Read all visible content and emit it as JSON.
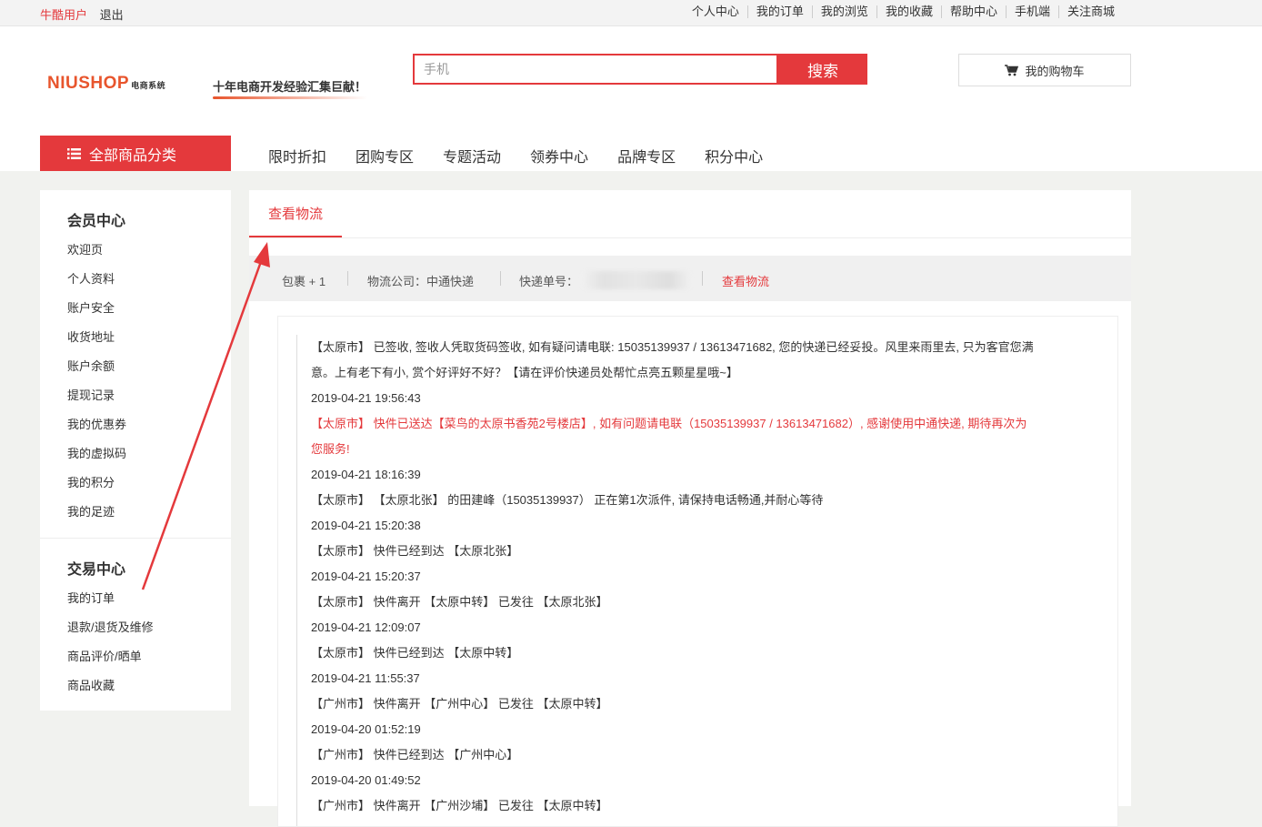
{
  "topbar": {
    "user": "牛酷用户",
    "logout": "退出",
    "links": [
      "个人中心",
      "我的订单",
      "我的浏览",
      "我的收藏",
      "帮助中心",
      "手机端",
      "关注商城"
    ]
  },
  "header": {
    "logo": "NIUSHOP",
    "logo_sub": "电商系统",
    "slogan": "十年电商开发经验汇集巨献！",
    "search_placeholder": "手机",
    "search_button": "搜索",
    "cart_label": "我的购物车"
  },
  "nav": {
    "all_categories": "全部商品分类",
    "items": [
      "限时折扣",
      "团购专区",
      "专题活动",
      "领券中心",
      "品牌专区",
      "积分中心"
    ]
  },
  "sidebar": {
    "member_title": "会员中心",
    "member_items": [
      "欢迎页",
      "个人资料",
      "账户安全",
      "收货地址",
      "账户余额",
      "提现记录",
      "我的优惠券",
      "我的虚拟码",
      "我的积分",
      "我的足迹"
    ],
    "trade_title": "交易中心",
    "trade_items": [
      "我的订单",
      "退款/退货及维修",
      "商品评价/晒单",
      "商品收藏"
    ]
  },
  "main": {
    "tab": "查看物流",
    "package": "包裹 + 1",
    "company": "物流公司：中通快递",
    "tracking_label": "快递单号：",
    "view_link": "查看物流"
  },
  "tracking": [
    {
      "text": "【太原市】 已签收, 签收人凭取货码签收, 如有疑问请电联: 15035139937 / 13613471682, 您的快递已经妥投。风里来雨里去, 只为客官您满",
      "red": false
    },
    {
      "text": "意。上有老下有小, 赏个好评好不好？【请在评价快递员处帮忙点亮五颗星星哦~】",
      "red": false
    },
    {
      "text": "2019-04-21 19:56:43",
      "red": false
    },
    {
      "text": "【太原市】 快件已送达【菜鸟的太原书香苑2号楼店】, 如有问题请电联（15035139937 / 13613471682）, 感谢使用中通快递, 期待再次为",
      "red": true
    },
    {
      "text": "您服务!",
      "red": true
    },
    {
      "text": "2019-04-21 18:16:39",
      "red": false
    },
    {
      "text": "【太原市】 【太原北张】 的田建峰（15035139937） 正在第1次派件, 请保持电话畅通,并耐心等待",
      "red": false
    },
    {
      "text": "2019-04-21 15:20:38",
      "red": false
    },
    {
      "text": "【太原市】 快件已经到达 【太原北张】",
      "red": false
    },
    {
      "text": "2019-04-21 15:20:37",
      "red": false
    },
    {
      "text": "【太原市】 快件离开 【太原中转】 已发往 【太原北张】",
      "red": false
    },
    {
      "text": "2019-04-21 12:09:07",
      "red": false
    },
    {
      "text": "【太原市】 快件已经到达 【太原中转】",
      "red": false
    },
    {
      "text": "2019-04-21 11:55:37",
      "red": false
    },
    {
      "text": "【广州市】 快件离开 【广州中心】 已发往 【太原中转】",
      "red": false
    },
    {
      "text": "2019-04-20 01:52:19",
      "red": false
    },
    {
      "text": "【广州市】 快件已经到达 【广州中心】",
      "red": false
    },
    {
      "text": "2019-04-20 01:49:52",
      "red": false
    },
    {
      "text": "【广州市】 快件离开 【广州沙埔】 已发往 【太原中转】",
      "red": false
    }
  ],
  "colors": {
    "accent": "#e4393c",
    "logo": "#e8552d"
  }
}
